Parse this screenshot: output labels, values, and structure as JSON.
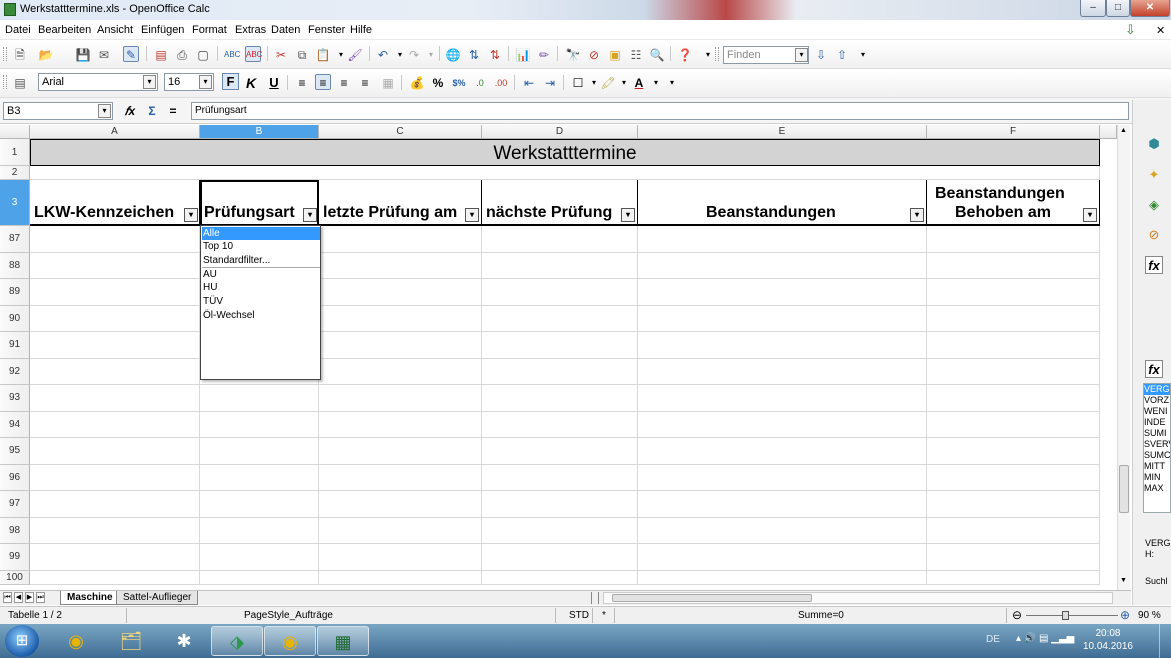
{
  "window": {
    "title": "Werkstatttermine.xls - OpenOffice Calc",
    "buttons": {
      "minimize": "–",
      "maximize": "□",
      "close": "✕"
    }
  },
  "menu": {
    "items": [
      "Datei",
      "Bearbeiten",
      "Ansicht",
      "Einfügen",
      "Format",
      "Extras",
      "Daten",
      "Fenster",
      "Hilfe"
    ]
  },
  "toolbar": {
    "find_placeholder": "Finden"
  },
  "formatting": {
    "font_name": "Arial",
    "font_size": "16",
    "bold_label": "F",
    "italic_label": "K",
    "underline_label": "U"
  },
  "formula_bar": {
    "cell_ref": "B3",
    "fx": "𝑓x",
    "sum": "Σ",
    "equals": "=",
    "content": "Prüfungsart"
  },
  "sheet": {
    "columns": [
      "A",
      "B",
      "C",
      "D",
      "E",
      "F"
    ],
    "title": "Werkstatttermine",
    "headers": [
      "LKW-Kennzeichen",
      "Prüfungsart",
      "letzte Prüfung am",
      "nächste Prüfung",
      "Beanstandungen",
      "Beanstandungen",
      "Behoben am"
    ],
    "rows": [
      "1",
      "2",
      "3",
      "87",
      "88",
      "89",
      "90",
      "91",
      "92",
      "93",
      "94",
      "95",
      "96",
      "97",
      "98",
      "99",
      "100"
    ]
  },
  "autofilter_popup": {
    "items": [
      "Alle",
      "Top 10",
      "Standardfilter...",
      "AU",
      "HU",
      "TÜV",
      "Öl-Wechsel"
    ],
    "selected": "Alle"
  },
  "sheet_tabs": {
    "tabs": [
      "Maschine",
      "Sattel-Auflieger"
    ],
    "active": "Maschine"
  },
  "function_list": [
    "VERG",
    "VORZ",
    "WENI",
    "INDE",
    "SUMI",
    "SVERV",
    "SUMC",
    "MITT",
    "MIN",
    "MAX",
    "VERG",
    "H:",
    "Suchl"
  ],
  "status": {
    "sheet": "Tabelle 1 / 2",
    "page_style": "PageStyle_Aufträge",
    "mode": "STD",
    "modified": "*",
    "sum": "Summe=0",
    "zoom": "90 %"
  },
  "taskbar": {
    "lang": "DE",
    "time": "20:08",
    "date": "10.04.2016"
  }
}
